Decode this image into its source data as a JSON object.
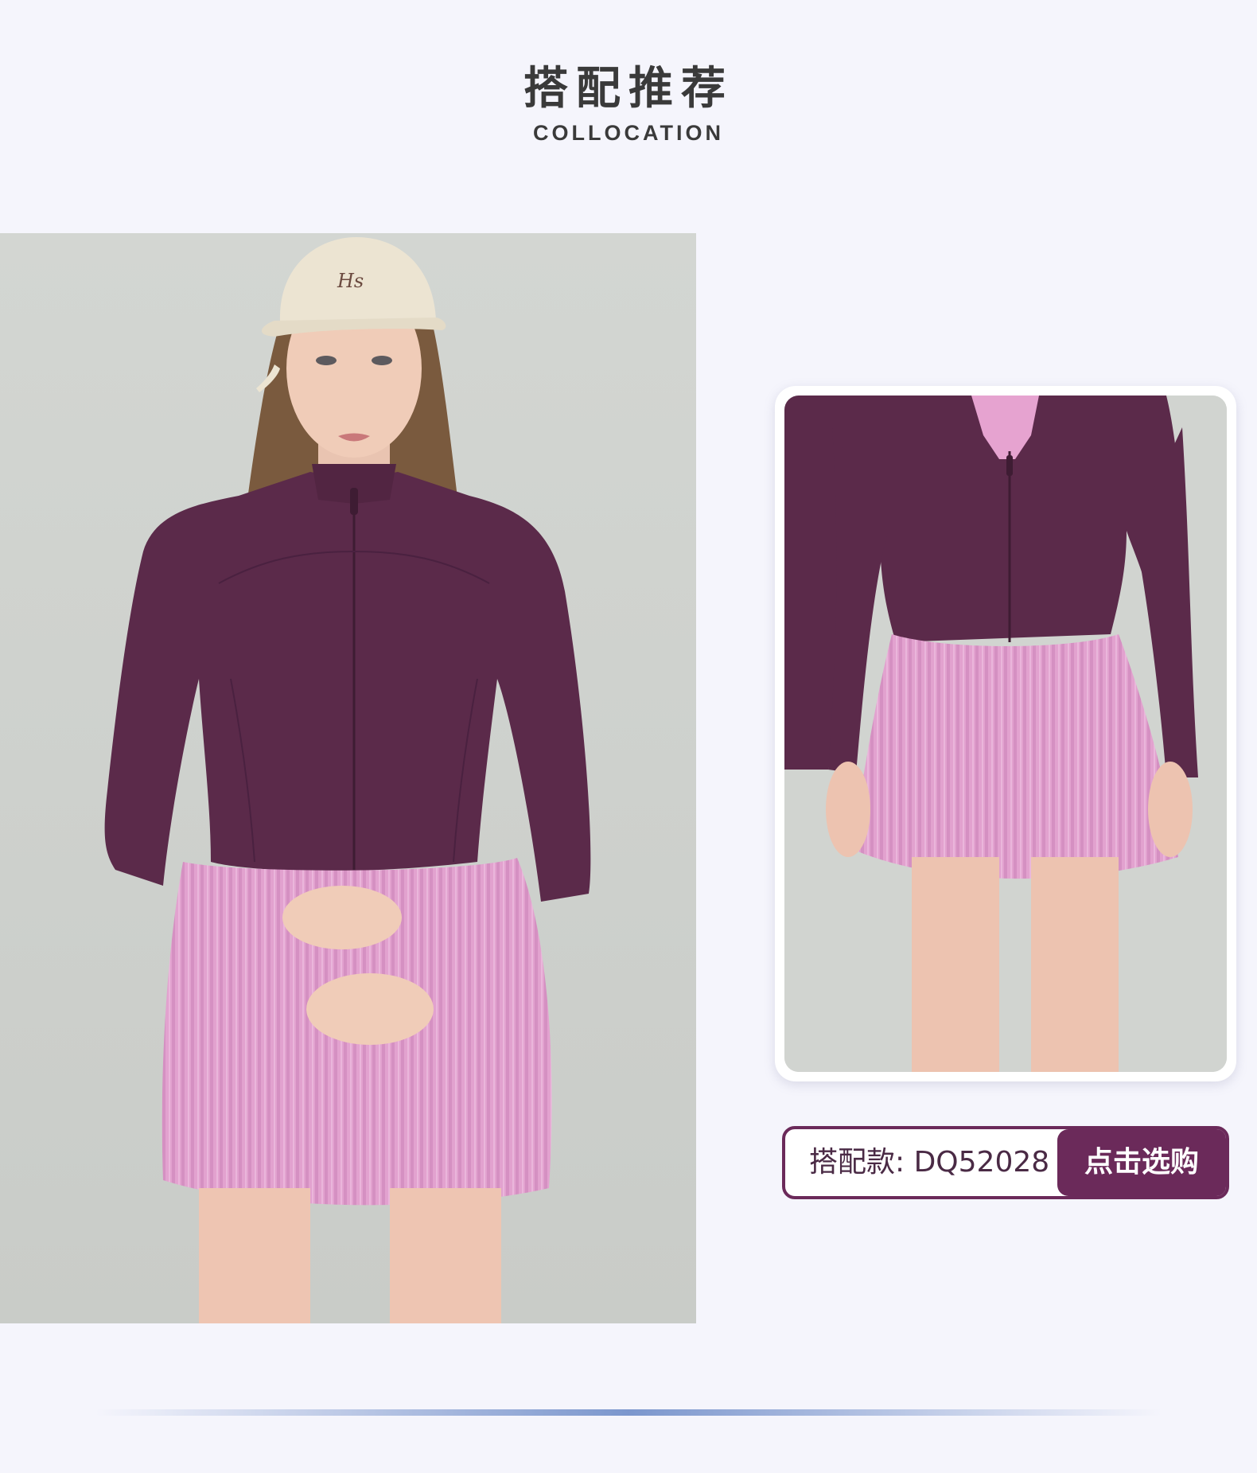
{
  "header": {
    "title_cn": "搭配推荐",
    "title_en": "COLLOCATION"
  },
  "main_photo": {
    "cap_logo": "Hs",
    "colors": {
      "background": "#d0d3cf",
      "jacket": "#5b2a4a",
      "skirt": "#e3a0cf",
      "cap": "#ece4d2"
    }
  },
  "detail_photo": {
    "colors": {
      "background": "#d0d3cf",
      "jacket": "#5b2a4a",
      "skirt": "#e3a0cf"
    }
  },
  "buy": {
    "item_label": "搭配款: DQ52028",
    "button_label": "点击选购",
    "accent_color": "#6b2a5a"
  }
}
